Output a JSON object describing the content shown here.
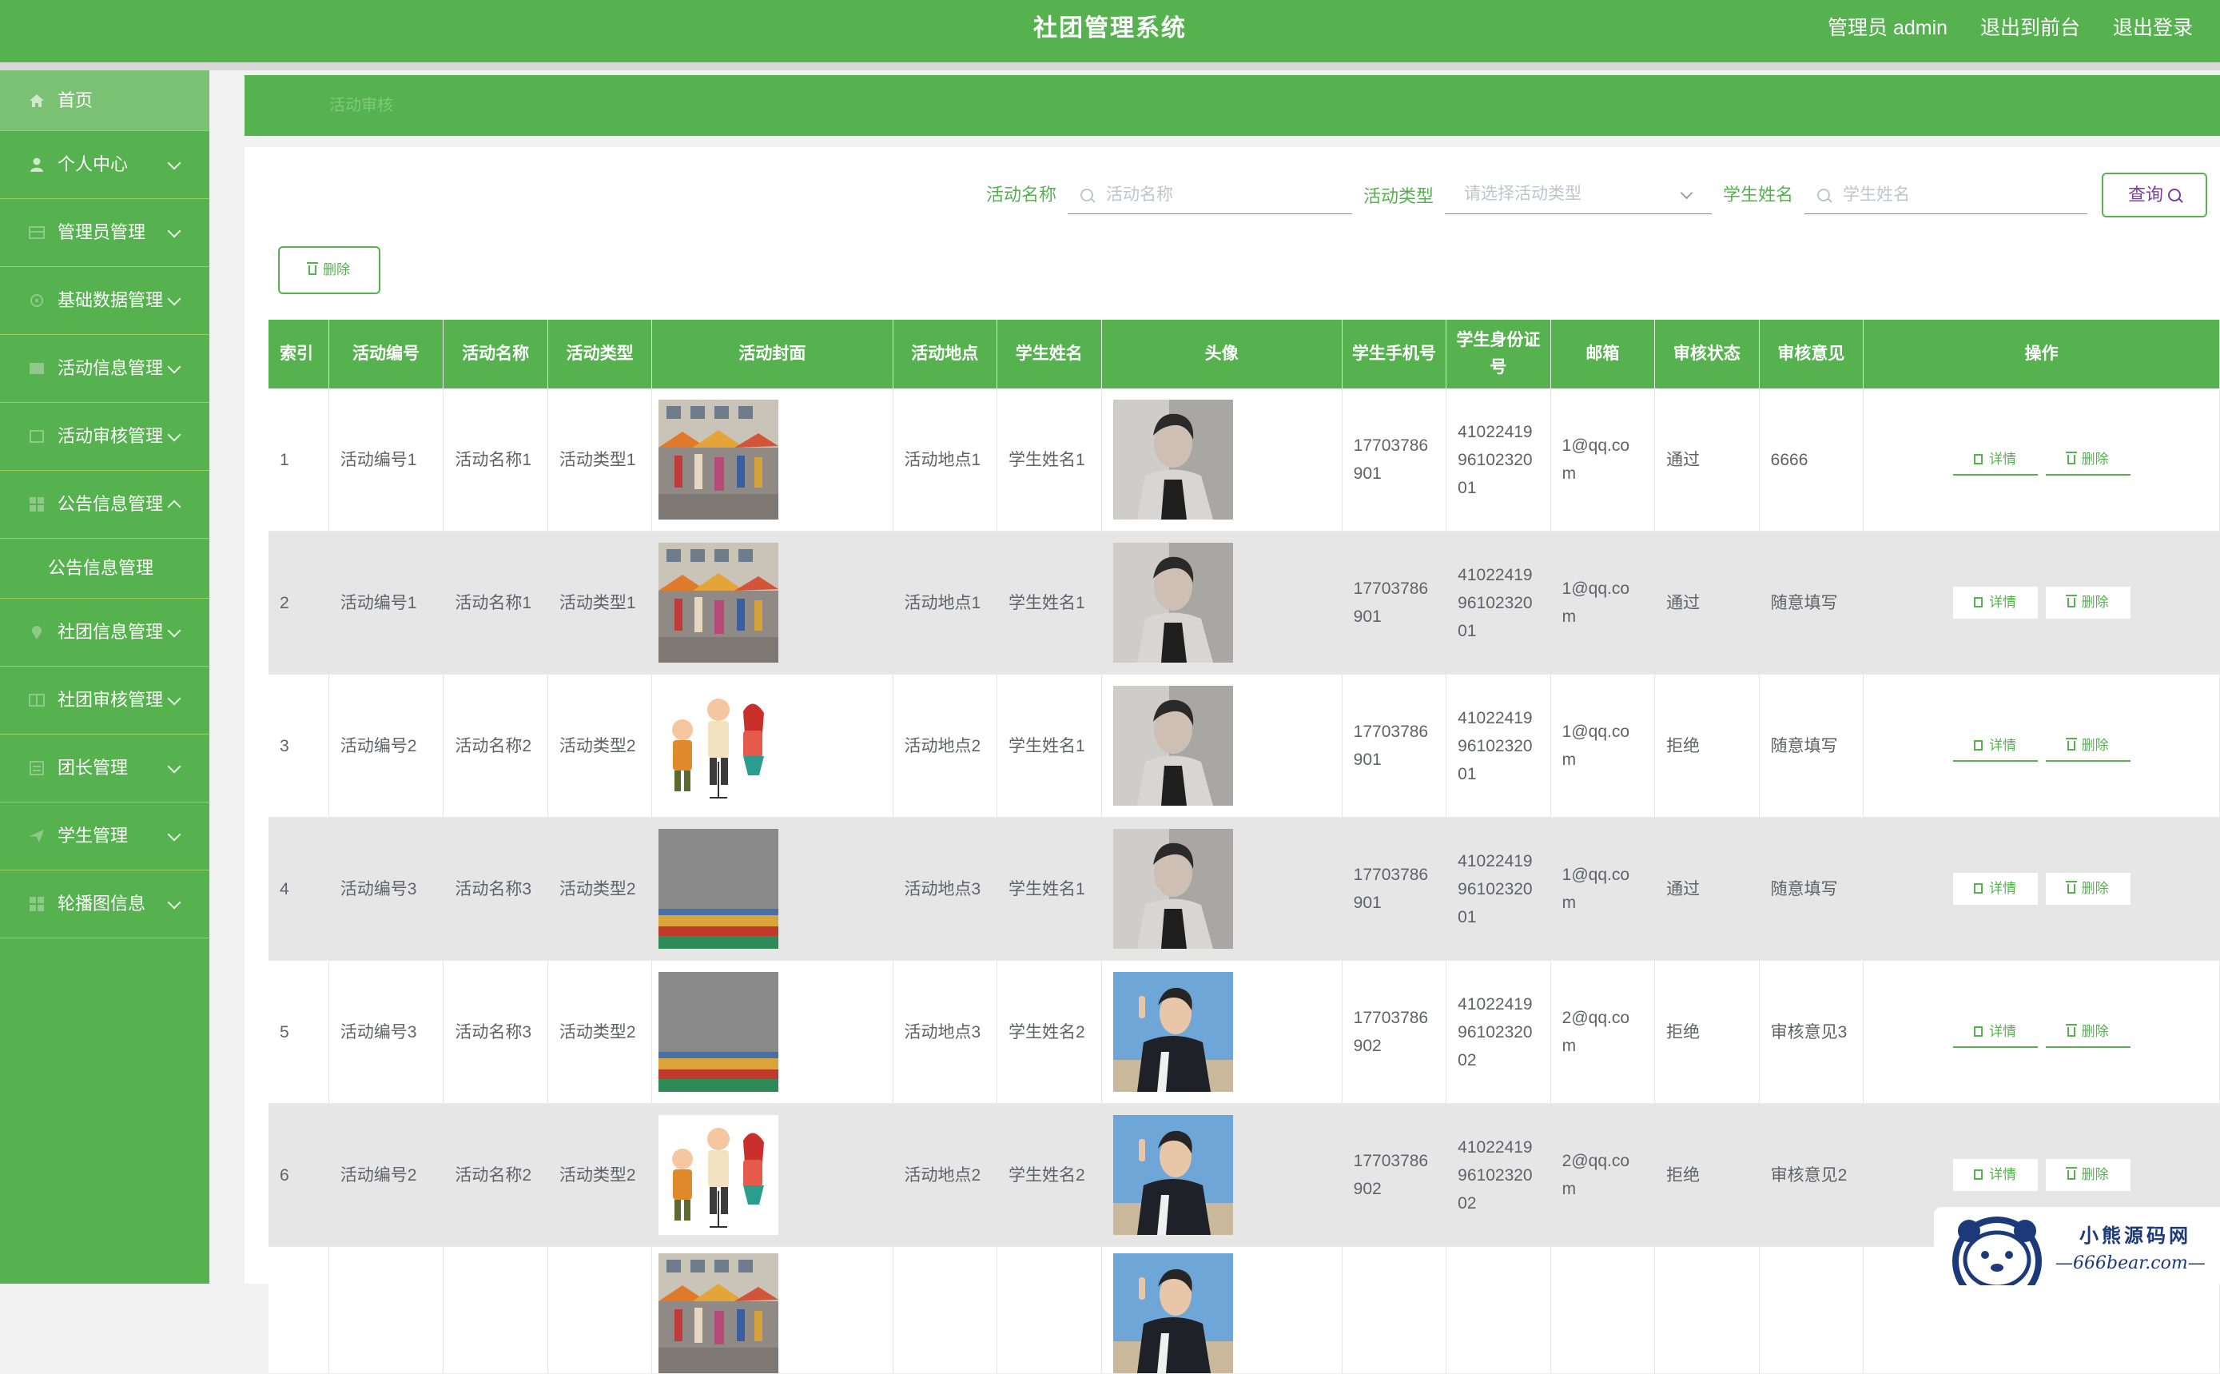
{
  "header": {
    "title": "社团管理系统",
    "user": "管理员 admin",
    "to_front": "退出到前台",
    "logout": "退出登录"
  },
  "sidebar": {
    "items": [
      {
        "label": "首页",
        "icon": "home-icon"
      },
      {
        "label": "个人中心",
        "icon": "user-icon"
      },
      {
        "label": "管理员管理",
        "icon": "grid-icon"
      },
      {
        "label": "基础数据管理",
        "icon": "grid-icon"
      },
      {
        "label": "活动信息管理",
        "icon": "grid-icon"
      },
      {
        "label": "活动审核管理",
        "icon": "grid-icon"
      },
      {
        "label": "公告信息管理",
        "icon": "grid-icon"
      },
      {
        "label": "社团信息管理",
        "icon": "grid-icon"
      },
      {
        "label": "社团审核管理",
        "icon": "grid-icon"
      },
      {
        "label": "团长管理",
        "icon": "grid-icon"
      },
      {
        "label": "学生管理",
        "icon": "grid-icon"
      },
      {
        "label": "轮播图信息",
        "icon": "grid-icon"
      }
    ],
    "submenu_notice": "公告信息管理"
  },
  "breadcrumb": "活动审核",
  "search": {
    "activity_name_label": "活动名称",
    "activity_name_placeholder": "活动名称",
    "activity_type_label": "活动类型",
    "activity_type_placeholder": "请选择活动类型",
    "student_name_label": "学生姓名",
    "student_name_placeholder": "学生姓名",
    "query_button": "查询"
  },
  "toolbar": {
    "delete_label": "删除"
  },
  "table": {
    "headers": [
      "索引",
      "活动编号",
      "活动名称",
      "活动类型",
      "活动封面",
      "活动地点",
      "学生姓名",
      "头像",
      "学生手机号",
      "学生身份证号",
      "邮箱",
      "审核状态",
      "审核意见",
      "操作"
    ],
    "detail_label": "详情",
    "delete_label": "删除",
    "rows": [
      {
        "index": "1",
        "code": "活动编号1",
        "name": "活动名称1",
        "type": "活动类型1",
        "cover": "street-fair",
        "place": "活动地点1",
        "student": "学生姓名1",
        "avatar": "bw-portrait",
        "phone": "17703786901",
        "idcard": "410224199610232001",
        "email": "1@qq.com",
        "status": "通过",
        "opinion": "6666"
      },
      {
        "index": "2",
        "code": "活动编号1",
        "name": "活动名称1",
        "type": "活动类型1",
        "cover": "street-fair",
        "place": "活动地点1",
        "student": "学生姓名1",
        "avatar": "bw-portrait",
        "phone": "17703786901",
        "idcard": "410224199610232001",
        "email": "1@qq.com",
        "status": "通过",
        "opinion": "随意填写"
      },
      {
        "index": "3",
        "code": "活动编号2",
        "name": "活动名称2",
        "type": "活动类型2",
        "cover": "cartoon-singers",
        "place": "活动地点2",
        "student": "学生姓名1",
        "avatar": "bw-portrait",
        "phone": "17703786901",
        "idcard": "410224199610232001",
        "email": "1@qq.com",
        "status": "拒绝",
        "opinion": "随意填写"
      },
      {
        "index": "4",
        "code": "活动编号3",
        "name": "活动名称3",
        "type": "活动类型2",
        "cover": "crowd",
        "place": "活动地点3",
        "student": "学生姓名1",
        "avatar": "bw-portrait",
        "phone": "17703786901",
        "idcard": "410224199610232001",
        "email": "1@qq.com",
        "status": "通过",
        "opinion": "随意填写"
      },
      {
        "index": "5",
        "code": "活动编号3",
        "name": "活动名称3",
        "type": "活动类型2",
        "cover": "crowd",
        "place": "活动地点3",
        "student": "学生姓名2",
        "avatar": "color-portrait",
        "phone": "17703786902",
        "idcard": "410224199610232002",
        "email": "2@qq.com",
        "status": "拒绝",
        "opinion": "审核意见3"
      },
      {
        "index": "6",
        "code": "活动编号2",
        "name": "活动名称2",
        "type": "活动类型2",
        "cover": "cartoon-singers",
        "place": "活动地点2",
        "student": "学生姓名2",
        "avatar": "color-portrait",
        "phone": "17703786902",
        "idcard": "410224199610232002",
        "email": "2@qq.com",
        "status": "拒绝",
        "opinion": "审核意见2"
      }
    ]
  },
  "watermark": {
    "line1": "小熊源码网",
    "line2": "—666bear.com—"
  },
  "colors": {
    "primary": "#55b24f",
    "row_alt": "#e6e6e6",
    "query_text": "#7b3fa0"
  }
}
